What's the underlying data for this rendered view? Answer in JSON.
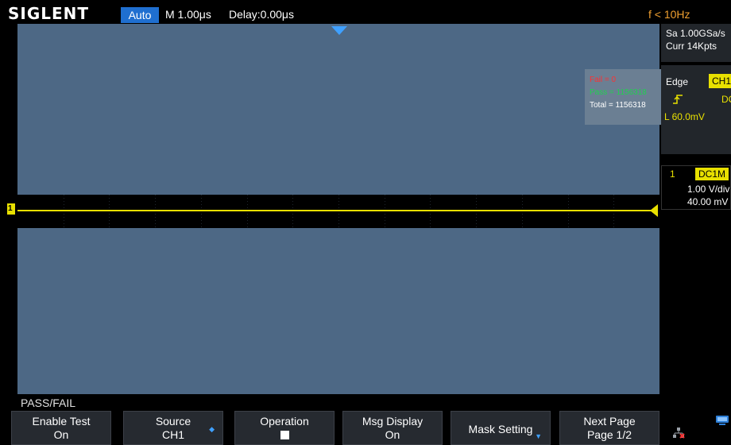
{
  "header": {
    "logo": "SIGLENT",
    "mode": "Auto",
    "timebase": "M 1.00μs",
    "delay": "Delay:0.00μs",
    "frequency": "f < 10Hz"
  },
  "stats": {
    "fail": "Fail = 0",
    "pass": "Pass = 1156318",
    "total": "Total = 1156318"
  },
  "acquisition": {
    "sample_rate": "Sa 1.00GSa/s",
    "memory": "Curr 14Kpts"
  },
  "trigger": {
    "type": "Edge",
    "source": "CH1",
    "slope_icon": "rising-edge-icon",
    "coupling": "DC",
    "level": "L  60.0mV"
  },
  "channel": {
    "number": "1",
    "coupling": "DC1M",
    "volts_per_div": "1.00 V/div",
    "offset": "40.00 mV",
    "marker": "1"
  },
  "menu": {
    "title": "PASS/FAIL",
    "softkeys": [
      {
        "line1": "Enable  Test",
        "line2": "On"
      },
      {
        "line1": "Source",
        "line2": "CH1"
      },
      {
        "line1": "Operation",
        "line2": ""
      },
      {
        "line1": "Msg  Display",
        "line2": "On"
      },
      {
        "line1": "Mask  Setting",
        "line2": ""
      },
      {
        "line1": "Next Page",
        "line2": "Page 1/2"
      }
    ]
  },
  "colors": {
    "mask": "#4d6885",
    "trace": "#e8e000",
    "accent": "#1f6fd0",
    "fail": "#ff3030",
    "pass": "#20d050"
  }
}
